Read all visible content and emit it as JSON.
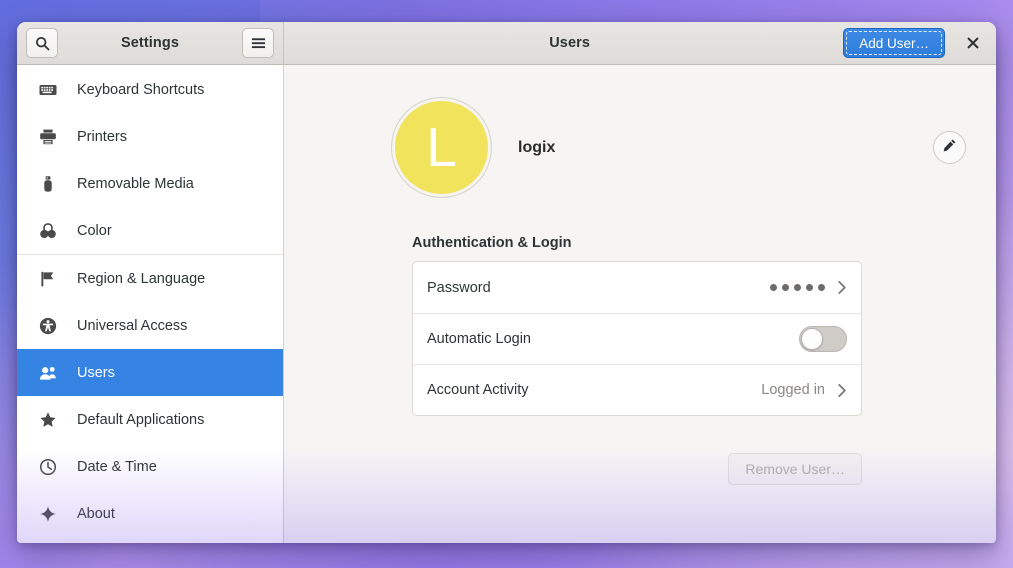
{
  "window": {
    "sidebar_header": {
      "search_icon": "search-icon",
      "title": "Settings",
      "menu_icon": "hamburger-menu-icon"
    },
    "content_header": {
      "title": "Users",
      "add_user_label": "Add User…",
      "close_icon": "close-icon"
    }
  },
  "sidebar": {
    "items": [
      {
        "label": "Keyboard Shortcuts",
        "icon": "keyboard-icon",
        "selected": false
      },
      {
        "label": "Printers",
        "icon": "printer-icon",
        "selected": false
      },
      {
        "label": "Removable Media",
        "icon": "usb-drive-icon",
        "selected": false
      },
      {
        "label": "Color",
        "icon": "color-circles-icon",
        "selected": false
      },
      {
        "label": "Region & Language",
        "icon": "flag-icon",
        "selected": false
      },
      {
        "label": "Universal Access",
        "icon": "accessibility-icon",
        "selected": false
      },
      {
        "label": "Users",
        "icon": "users-icon",
        "selected": true
      },
      {
        "label": "Default Applications",
        "icon": "star-icon",
        "selected": false
      },
      {
        "label": "Date & Time",
        "icon": "clock-icon",
        "selected": false
      },
      {
        "label": "About",
        "icon": "sparkle-icon",
        "selected": false
      }
    ],
    "separator_after_index": 3
  },
  "user": {
    "avatar_initial": "L",
    "avatar_color": "#f1e35b",
    "name": "logix",
    "edit_icon": "pencil-icon"
  },
  "main": {
    "section_title": "Authentication & Login",
    "rows": [
      {
        "label": "Password",
        "value": "•••••",
        "value_type": "dots",
        "dot_count": 5,
        "chevron": true
      },
      {
        "label": "Automatic Login",
        "value": "off",
        "value_type": "toggle",
        "chevron": false
      },
      {
        "label": "Account Activity",
        "value": "Logged in",
        "value_type": "text",
        "chevron": true
      }
    ],
    "remove_user_label": "Remove User…",
    "remove_user_disabled": true
  },
  "colors": {
    "accent": "#3584e4",
    "content_bg": "#f6f5f4",
    "header_bg": "#e1dedb",
    "sidebar_bg": "#ffffff"
  }
}
